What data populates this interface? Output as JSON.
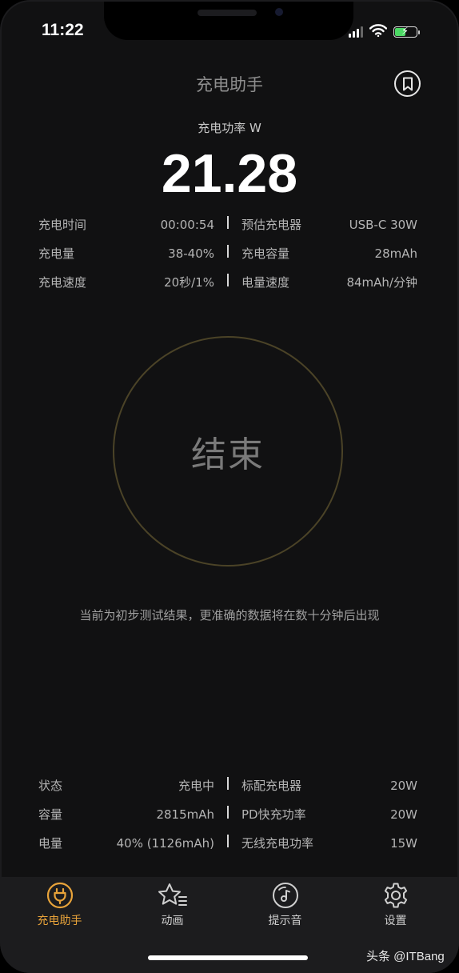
{
  "status_bar": {
    "time": "11:22",
    "icons": [
      "cellular-signal-icon",
      "wifi-icon",
      "battery-charging-icon"
    ]
  },
  "header": {
    "title": "充电助手",
    "bookmark_icon": "bookmark-icon"
  },
  "power": {
    "label": "充电功率 W",
    "value": "21.28"
  },
  "charge_stats": [
    {
      "label1": "充电时间",
      "value1": "00:00:54",
      "label2": "预估充电器",
      "value2": "USB-C 30W"
    },
    {
      "label1": "充电量",
      "value1": "38-40%",
      "label2": "充电容量",
      "value2": "28mAh"
    },
    {
      "label1": "充电速度",
      "value1": "20秒/1%",
      "label2": "电量速度",
      "value2": "84mAh/分钟"
    }
  ],
  "action": {
    "end_label": "结束"
  },
  "notice": "当前为初步测试结果，更准确的数据将在数十分钟后出现",
  "device_stats": [
    {
      "label1": "状态",
      "value1": "充电中",
      "label2": "标配充电器",
      "value2": "20W"
    },
    {
      "label1": "容量",
      "value1": "2815mAh",
      "label2": "PD快充功率",
      "value2": "20W"
    },
    {
      "label1": "电量",
      "value1": "40% (1126mAh)",
      "label2": "无线充电功率",
      "value2": "15W"
    }
  ],
  "tabs": [
    {
      "label": "充电助手",
      "icon": "plug-icon",
      "active": true
    },
    {
      "label": "动画",
      "icon": "star-list-icon",
      "active": false
    },
    {
      "label": "提示音",
      "icon": "music-disc-icon",
      "active": false
    },
    {
      "label": "设置",
      "icon": "gear-icon",
      "active": false
    }
  ],
  "colors": {
    "accent": "#e8a33a",
    "background": "#111112",
    "ring": "#4b4327",
    "tabbar": "#1c1c1e"
  },
  "watermark": "头条 @ITBang"
}
